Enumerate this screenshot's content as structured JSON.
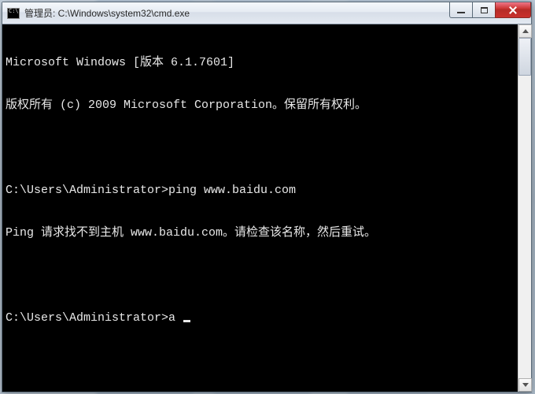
{
  "window": {
    "title": "管理员: C:\\Windows\\system32\\cmd.exe"
  },
  "terminal": {
    "lines": [
      "Microsoft Windows [版本 6.1.7601]",
      "版权所有 (c) 2009 Microsoft Corporation。保留所有权利。",
      "",
      "C:\\Users\\Administrator>ping www.baidu.com",
      "Ping 请求找不到主机 www.baidu.com。请检查该名称，然后重试。",
      ""
    ],
    "prompt": "C:\\Users\\Administrator>",
    "input_value": "a"
  }
}
